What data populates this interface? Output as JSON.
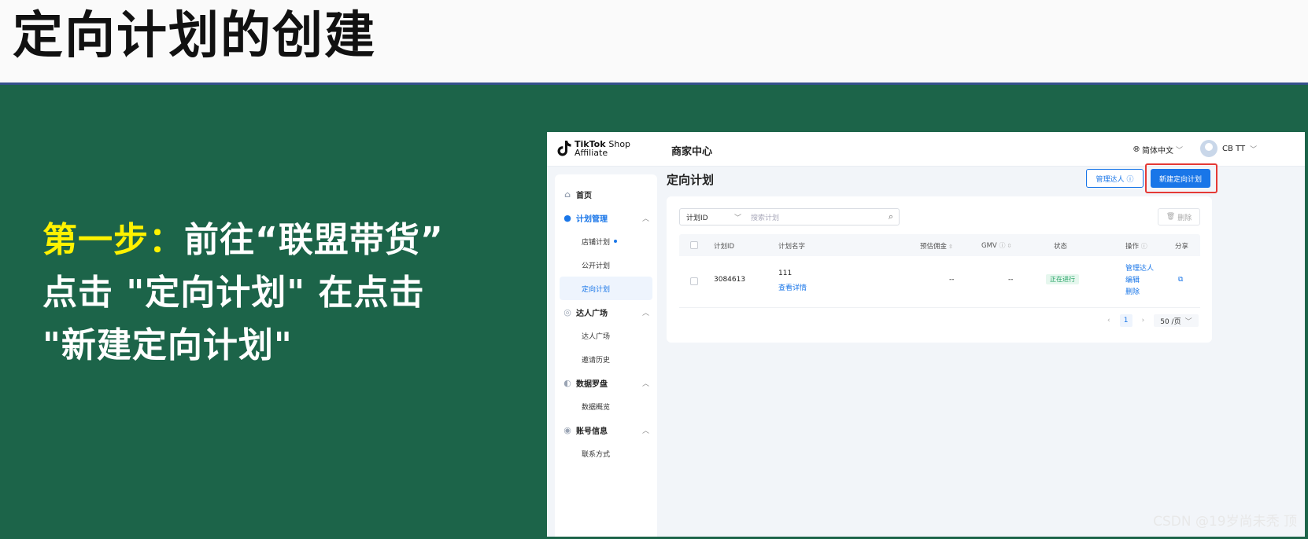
{
  "slide": {
    "title": "定向计划的创建",
    "step_label": "第一步：",
    "step_text": "前往“联盟带货” 点击 \"定向计划\" 在点击 \"新建定向计划\"",
    "watermark": "CSDN @19岁尚未秃 顶",
    "colors": {
      "background": "#1c6449",
      "highlight": "#fff200",
      "header": "#fafafa"
    }
  },
  "app": {
    "logo_brand": "TikTok",
    "logo_shop": "Shop",
    "logo_sub": "Affiliate",
    "center_title": "商家中心",
    "language": "简体中文",
    "user": "CB TT",
    "sidebar": [
      {
        "label": "首页",
        "icon": "home-icon"
      },
      {
        "label": "计划管理",
        "icon": "plan-icon",
        "active": true
      },
      {
        "label": "店铺计划",
        "sub": true
      },
      {
        "label": "公开计划",
        "sub": true
      },
      {
        "label": "定向计划",
        "sub": true,
        "selected": true
      },
      {
        "label": "达人广场",
        "icon": "creator-icon"
      },
      {
        "label": "达人广场",
        "sub": true
      },
      {
        "label": "邀请历史",
        "sub": true
      },
      {
        "label": "数据罗盘",
        "icon": "compass-icon"
      },
      {
        "label": "数据概览",
        "sub": true
      },
      {
        "label": "账号信息",
        "icon": "account-icon"
      },
      {
        "label": "联系方式",
        "sub": true
      }
    ],
    "page_title": "定向计划",
    "btn_manage": "管理达人",
    "btn_new": "新建定向计划",
    "filter": {
      "select": "计划ID",
      "placeholder": "搜索计划"
    },
    "btn_delete": "删除",
    "table": {
      "headers": {
        "id": "计划ID",
        "name": "计划名字",
        "commission": "预估佣金",
        "gmv": "GMV",
        "status": "状态",
        "ops": "操作",
        "share": "分享"
      },
      "rows": [
        {
          "id": "3084613",
          "name": "111",
          "detail": "查看详情",
          "commission": "--",
          "gmv": "--",
          "status": "正在进行",
          "ops": [
            "管理达人",
            "编辑",
            "删除"
          ]
        }
      ]
    },
    "pager": {
      "page": "1",
      "size": "50 /页"
    }
  }
}
